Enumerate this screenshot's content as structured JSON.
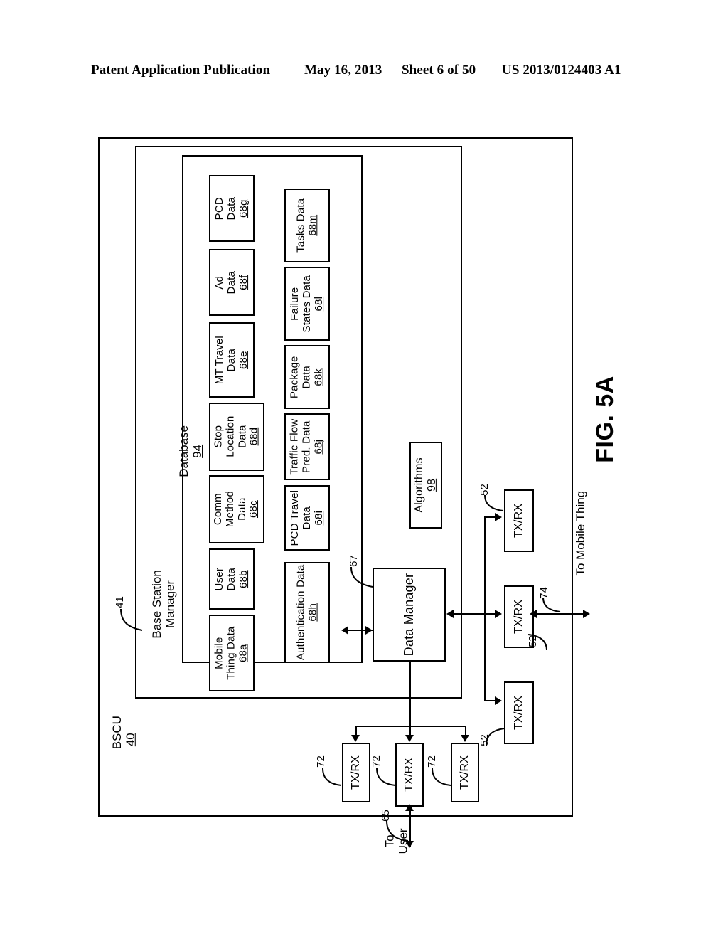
{
  "header": {
    "publication": "Patent Application Publication",
    "date": "May 16, 2013",
    "sheet": "Sheet 6 of 50",
    "patent_number": "US 2013/0124403 A1"
  },
  "figure": {
    "label": "FIG. 5A"
  },
  "outer": {
    "title": "BSCU",
    "ref": "40",
    "leader_ref": "41"
  },
  "base_station_manager": {
    "line1": "Base Station",
    "line2": "Manager"
  },
  "database": {
    "title": "Database",
    "ref": "94"
  },
  "database_boxes_col1": [
    {
      "lines": [
        "PCD",
        "Data"
      ],
      "ref": "68g"
    },
    {
      "lines": [
        "Ad",
        "Data"
      ],
      "ref": "68f"
    },
    {
      "lines": [
        "MT Travel",
        "Data"
      ],
      "ref": "68e"
    },
    {
      "lines": [
        "Stop",
        "Location",
        "Data"
      ],
      "ref": "68d"
    },
    {
      "lines": [
        "Comm",
        "Method",
        "Data"
      ],
      "ref": "68c"
    },
    {
      "lines": [
        "User",
        "Data"
      ],
      "ref": "68b"
    },
    {
      "lines": [
        "Mobile",
        "Thing Data"
      ],
      "ref": "68a"
    }
  ],
  "database_boxes_col2": [
    {
      "lines": [
        "Tasks Data"
      ],
      "ref": "68m"
    },
    {
      "lines": [
        "Failure",
        "States Data"
      ],
      "ref": "68l"
    },
    {
      "lines": [
        "Package",
        "Data"
      ],
      "ref": "68k"
    },
    {
      "lines": [
        "Traffic Flow",
        "Pred. Data"
      ],
      "ref": "68j"
    },
    {
      "lines": [
        "PCD Travel",
        "Data"
      ],
      "ref": "68i"
    },
    {
      "lines": [
        "Authentication Data"
      ],
      "ref": "68h"
    }
  ],
  "algorithms": {
    "title": "Algorithms",
    "ref": "98"
  },
  "data_manager": {
    "title": "Data Manager",
    "bus_ref": "67"
  },
  "transceivers_user": [
    {
      "label": "TX/RX",
      "ref": "72"
    },
    {
      "label": "TX/RX",
      "ref": "72"
    },
    {
      "label": "TX/RX",
      "ref": "72"
    }
  ],
  "transceivers_mobile": [
    {
      "label": "TX/RX",
      "ref": "52"
    },
    {
      "label": "TX/RX",
      "ref": "52"
    },
    {
      "label": "TX/RX",
      "ref": "52"
    }
  ],
  "ports": {
    "user_line1": "To",
    "user_line2": "User",
    "user_ref": "65",
    "mobile_label": "To Mobile Thing",
    "mobile_ref": "74",
    "mobile_extra_ref": "52"
  }
}
